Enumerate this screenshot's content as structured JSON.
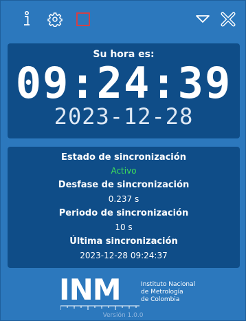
{
  "toolbar": {
    "icons": [
      "info-icon",
      "gear-icon",
      "square-icon",
      "chevron-down-icon",
      "close-icon"
    ],
    "square_color": "#e23b3b"
  },
  "clock": {
    "label": "Su hora es:",
    "time": "09:24:39",
    "date": "2023-12-28"
  },
  "sync": {
    "status_heading": "Estado de sincronización",
    "status_value": "Activo",
    "offset_heading": "Desfase de sincronización",
    "offset_value": "0.237 s",
    "period_heading": "Periodo de sincronización",
    "period_value": "10 s",
    "last_heading": "Última sincronización",
    "last_value": "2023-12-28 09:24:37"
  },
  "logo": {
    "inm": "INM",
    "line1": "Instituto Nacional",
    "line2": "de Metrología",
    "line3": "de Colombia"
  },
  "version": "Versión 1.0.0",
  "colors": {
    "background": "#2c78bd",
    "panel": "#0f4d88",
    "status_active": "#3ee05a"
  }
}
